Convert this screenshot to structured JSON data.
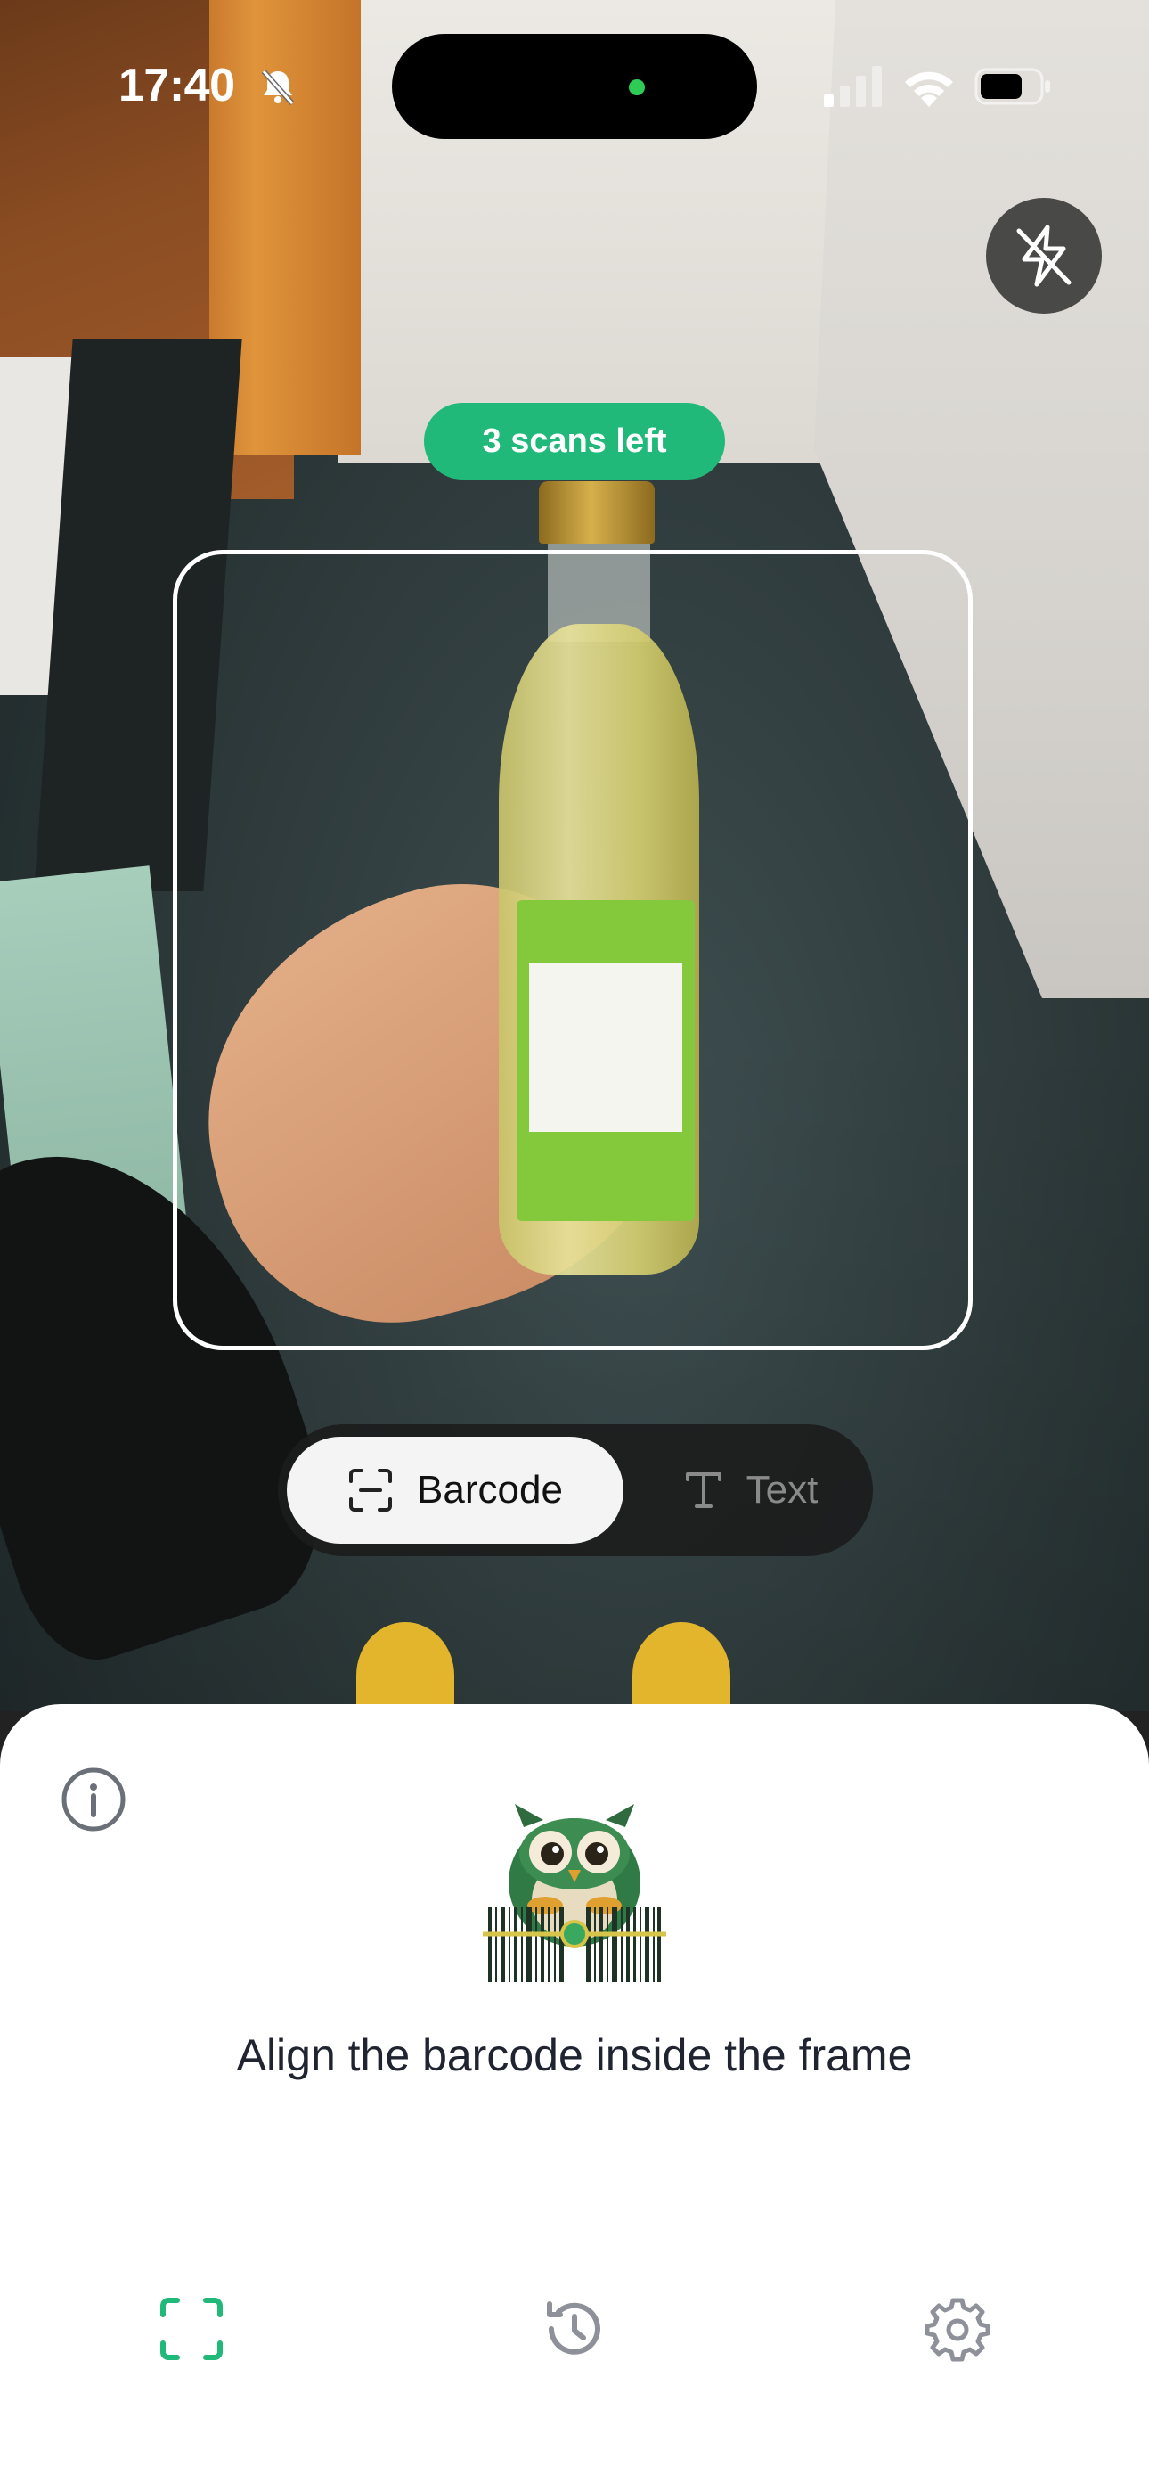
{
  "status_bar": {
    "time": "17:40",
    "icons": [
      "bell-slash-icon",
      "cellular-signal-icon",
      "wifi-icon",
      "battery-icon"
    ]
  },
  "camera": {
    "flash_icon": "flash-off-icon",
    "scans_left": "3 scans left"
  },
  "mode_switch": {
    "options": [
      {
        "label": "Barcode",
        "icon": "barcode-scan-icon",
        "selected": true
      },
      {
        "label": "Text",
        "icon": "text-icon",
        "selected": false
      }
    ]
  },
  "sheet": {
    "instruction": "Align the barcode inside the frame",
    "info_icon": "info-icon",
    "mascot": "owl-barcode-mascot"
  },
  "tab_bar": {
    "items": [
      {
        "icon": "scan-frame-icon",
        "active": true
      },
      {
        "icon": "history-icon",
        "active": false
      },
      {
        "icon": "settings-gear-icon",
        "active": false
      }
    ]
  },
  "colors": {
    "accent": "#20b97a",
    "inactive_icon": "#8e9199",
    "sheet_text": "#1f2430"
  }
}
